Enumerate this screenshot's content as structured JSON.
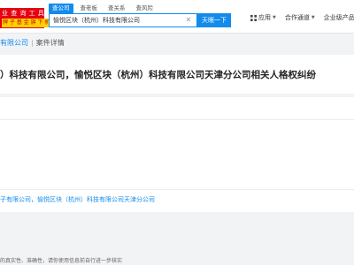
{
  "logo": {
    "line1": "业 查 询 工 具",
    "line2": "牌 子 基 金 旗 下 机 构"
  },
  "search": {
    "tabs": [
      "查公司",
      "查老板",
      "查关系",
      "查风险"
    ],
    "value": "愉悦区块（杭州）科技有限公司",
    "button": "天眼一下"
  },
  "nav": {
    "app": "应用",
    "coop": "合作通道",
    "enterprise": "企业级产品"
  },
  "breadcrumb": {
    "company": "有限公司",
    "current": "案件详情"
  },
  "case": {
    "title": "）科技有限公司，愉悦区块（杭州）科技有限公司天津分公司相关人格权纠纷",
    "related": "子有限公司，愉悦区块（杭州）科技有限公司天津分公司"
  },
  "footer": {
    "note": "的真实性、准确性，请你使用信息前自行进一步核实"
  },
  "colors": {
    "brand_blue": "#128bed",
    "logo_red": "#e60012",
    "logo_yellow": "#ffd200"
  },
  "icons": [
    "clear-icon",
    "app-grid-icon",
    "handshake-icon",
    "chevron-down-icon"
  ]
}
